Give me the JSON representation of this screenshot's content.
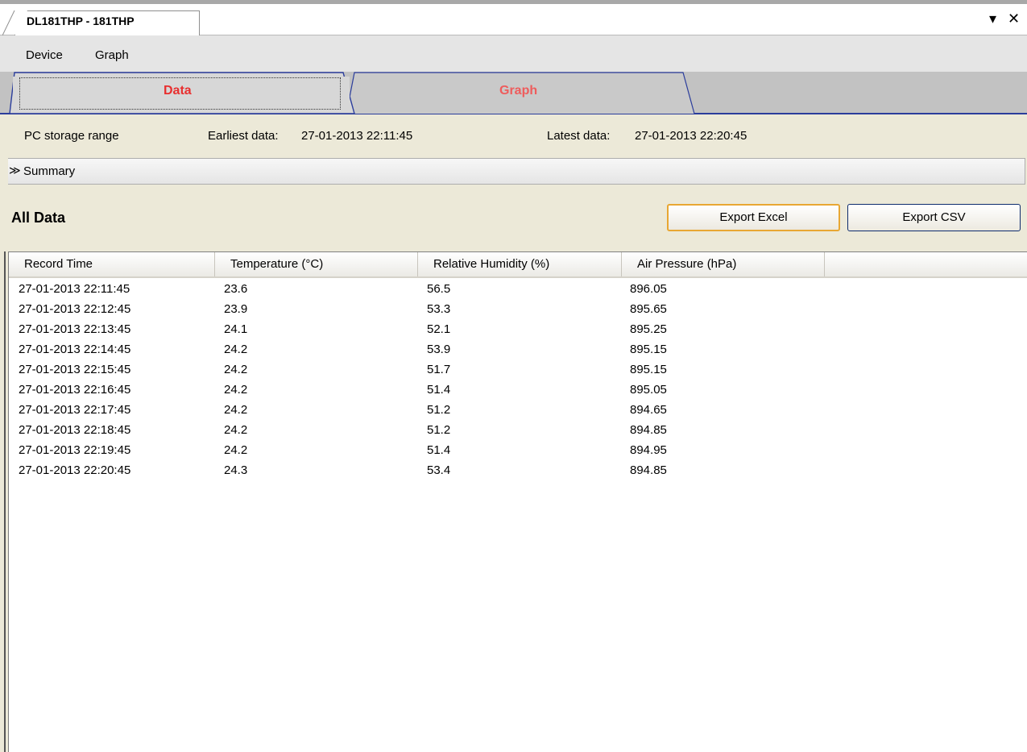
{
  "document_tab": {
    "title": "DL181THP - 181THP"
  },
  "window_controls": {
    "dropdown_glyph": "▾",
    "close_glyph": "✕"
  },
  "menu": {
    "items": [
      "Device",
      "Graph"
    ]
  },
  "view_tabs": [
    {
      "label": "Data",
      "active": true
    },
    {
      "label": "Graph",
      "active": false
    }
  ],
  "storage_range": {
    "label": "PC storage range",
    "earliest_label": "Earliest data:",
    "earliest_value": "27-01-2013 22:11:45",
    "latest_label": "Latest data:",
    "latest_value": "27-01-2013 22:20:45"
  },
  "summary": {
    "chevron": "≫",
    "label": "Summary",
    "collapsed": true
  },
  "section": {
    "title": "All Data"
  },
  "buttons": {
    "export_excel": "Export Excel",
    "export_csv": "Export CSV"
  },
  "table": {
    "columns": [
      "Record Time",
      "Temperature (°C)",
      "Relative Humidity (%)",
      "Air Pressure (hPa)"
    ],
    "rows": [
      [
        "27-01-2013 22:11:45",
        "23.6",
        "56.5",
        "896.05"
      ],
      [
        "27-01-2013 22:12:45",
        "23.9",
        "53.3",
        "895.65"
      ],
      [
        "27-01-2013 22:13:45",
        "24.1",
        "52.1",
        "895.25"
      ],
      [
        "27-01-2013 22:14:45",
        "24.2",
        "53.9",
        "895.15"
      ],
      [
        "27-01-2013 22:15:45",
        "24.2",
        "51.7",
        "895.15"
      ],
      [
        "27-01-2013 22:16:45",
        "24.2",
        "51.4",
        "895.05"
      ],
      [
        "27-01-2013 22:17:45",
        "24.2",
        "51.2",
        "894.65"
      ],
      [
        "27-01-2013 22:18:45",
        "24.2",
        "51.2",
        "894.85"
      ],
      [
        "27-01-2013 22:19:45",
        "24.2",
        "51.4",
        "894.95"
      ],
      [
        "27-01-2013 22:20:45",
        "24.3",
        "53.4",
        "894.85"
      ]
    ]
  },
  "colors": {
    "active_tab_text": "#e82f2f",
    "tab_accent_border": "#2b3d9c",
    "primary_button_border": "#e8a733"
  }
}
